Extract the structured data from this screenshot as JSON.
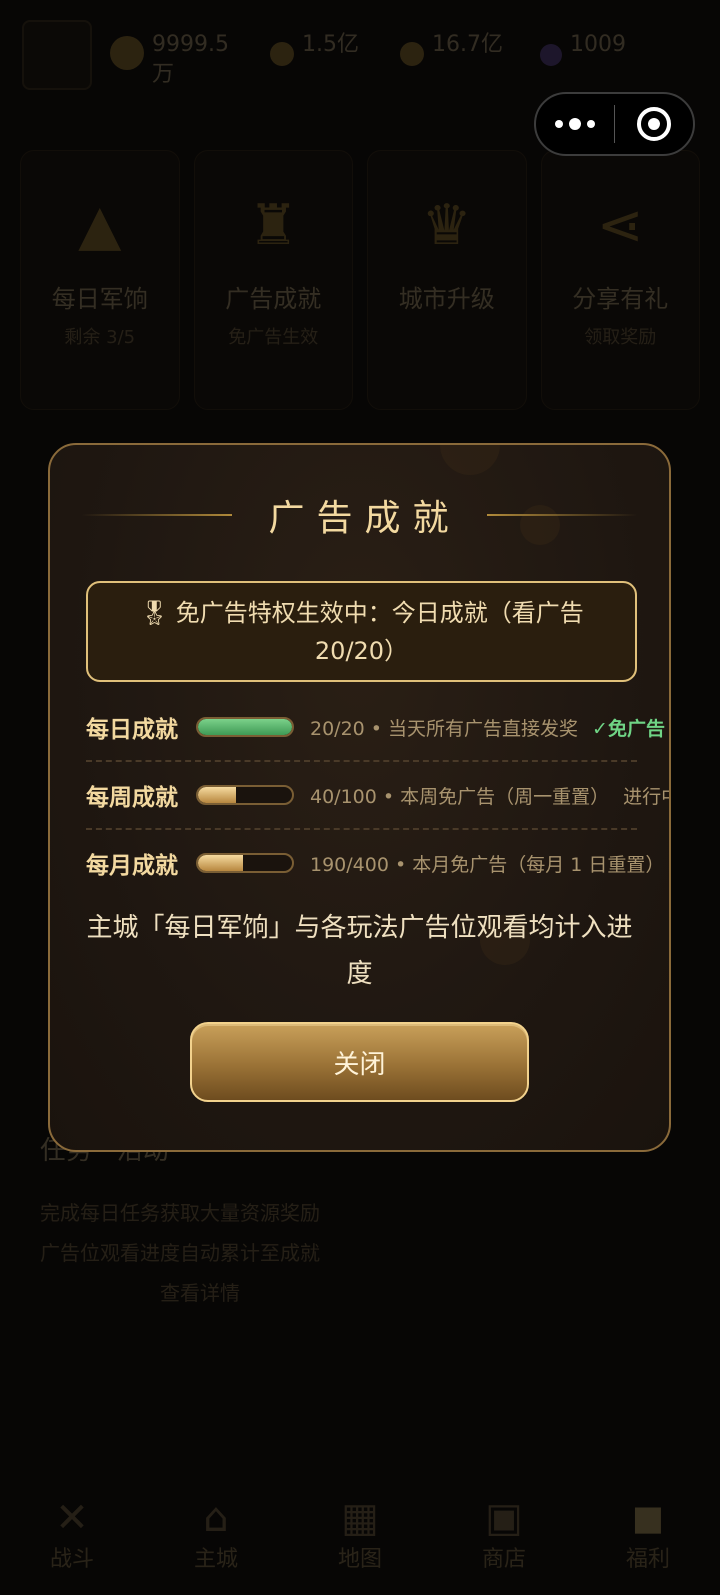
{
  "background": {
    "resources": [
      {
        "icon": "gold-coin-icon",
        "value": "9999.5万"
      },
      {
        "icon": "food-icon",
        "value": "1.5亿"
      },
      {
        "icon": "wood-icon",
        "value": "16.7亿"
      },
      {
        "icon": "gem-icon",
        "value": "1009"
      }
    ],
    "cards": [
      {
        "icon": "tent-icon",
        "title": "每日军饷",
        "sub": "剩余 3/5"
      },
      {
        "icon": "trophy-icon",
        "title": "广告成就",
        "sub": "免广告生效"
      },
      {
        "icon": "castle-icon",
        "title": "城市升级",
        "sub": ""
      },
      {
        "icon": "share-icon",
        "title": "分享有礼",
        "sub": "领取奖励"
      }
    ],
    "section": {
      "heading": "任务 · 活动",
      "line1": "完成每日任务获取大量资源奖励",
      "line2": "广告位观看进度自动累计至成就",
      "line3": "查看详情"
    },
    "tabs": [
      {
        "icon": "sword-icon",
        "label": "战斗"
      },
      {
        "icon": "castle-icon",
        "label": "主城"
      },
      {
        "icon": "map-icon",
        "label": "地图"
      },
      {
        "icon": "shop-icon",
        "label": "商店"
      },
      {
        "icon": "gift-icon",
        "label": "福利"
      }
    ]
  },
  "capsule": {
    "more_icon": "more-dots-icon",
    "close_icon": "target-close-icon"
  },
  "modal": {
    "title": "广告成就",
    "privilege_text": "免广告特权生效中：今日成就（看广告 20/20）",
    "privilege_icon": "medal-icon",
    "achievements": [
      {
        "label": "每日成就",
        "progress": 1.0,
        "color": "green",
        "info": "20/20 • 当天所有广告直接发奖",
        "status": "✓免广告",
        "status_type": "done"
      },
      {
        "label": "每周成就",
        "progress": 0.4,
        "color": "gold",
        "info": "40/100 • 本周免广告（周一重置）",
        "status": "进行中",
        "status_type": "prog"
      },
      {
        "label": "每月成就",
        "progress": 0.475,
        "color": "gold",
        "info": "190/400 • 本月免广告（每月 1 日重置）",
        "status": "",
        "status_type": "prog"
      }
    ],
    "note": "主城「每日军饷」与各玩法广告位观看均计入进度",
    "close_label": "关闭"
  }
}
